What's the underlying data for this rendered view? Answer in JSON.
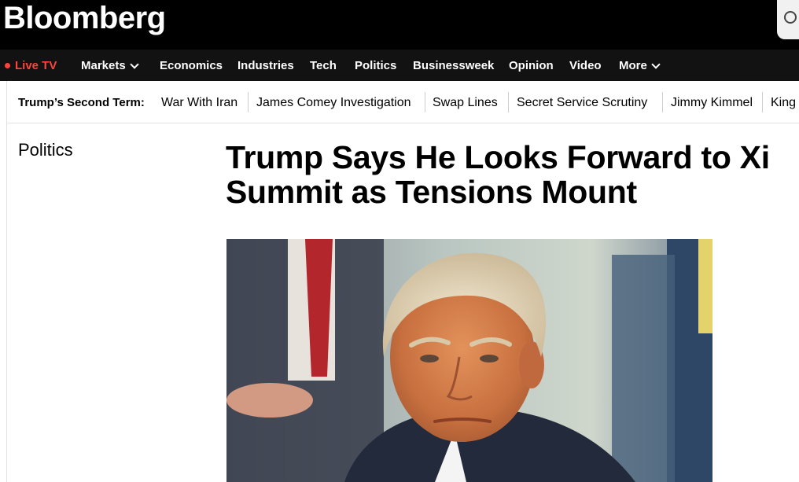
{
  "header": {
    "logo": "Bloomberg"
  },
  "nav": {
    "live_tv": "Live TV",
    "items": [
      "Markets",
      "Economics",
      "Industries",
      "Tech",
      "Politics",
      "Businessweek",
      "Opinion",
      "Video",
      "More"
    ]
  },
  "topics": {
    "heading": "Trump’s Second Term:",
    "links": [
      "War With Iran",
      "James Comey Investigation",
      "Swap Lines",
      "Secret Service Scrutiny",
      "Jimmy Kimmel",
      "King"
    ]
  },
  "article": {
    "section": "Politics",
    "headline": "Trump Says He Looks Forward to Xi Summit as Tensions Mount"
  },
  "colors": {
    "masthead": "#000000",
    "navbar": "#121212",
    "live_accent": "#ff433d"
  }
}
